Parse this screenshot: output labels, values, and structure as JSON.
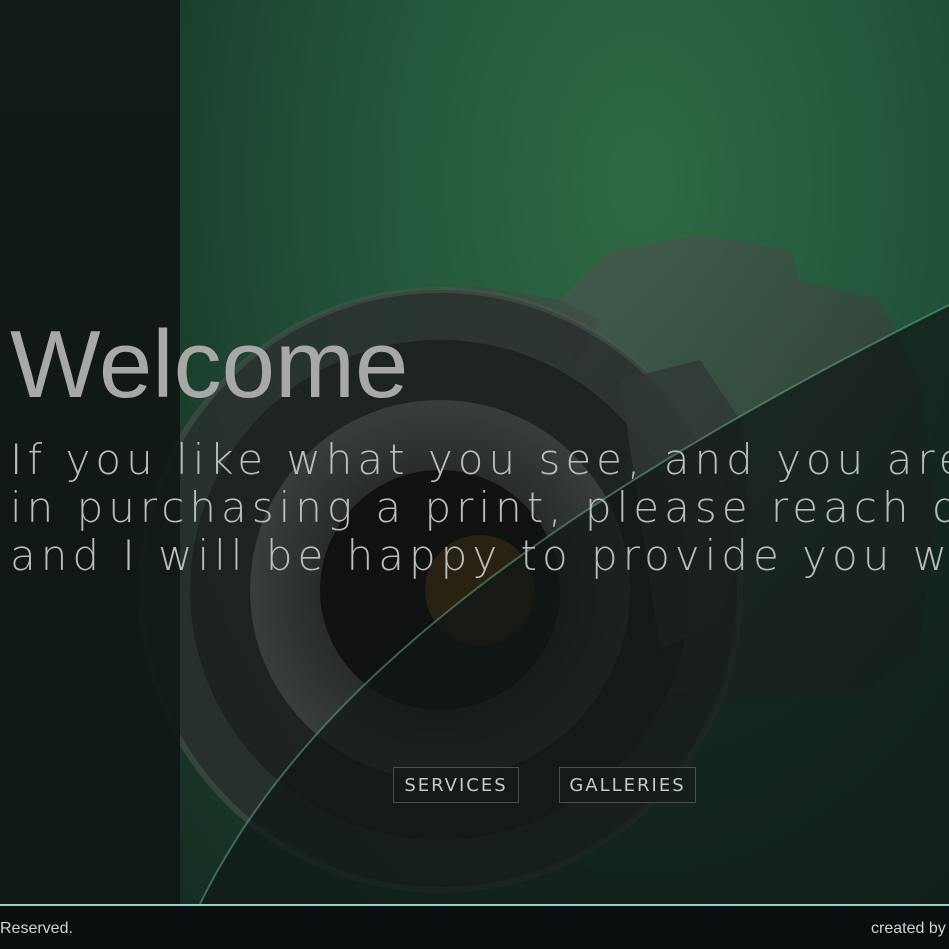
{
  "hero": {
    "heading": "Welcome",
    "intro_lines": [
      "If you like what you see, and you are inte",
      "in purchasing a print, please reach out to",
      "and I will be happy to provide you with a"
    ]
  },
  "buttons": {
    "services_label": "SERVICES",
    "galleries_label": "GALLERIES"
  },
  "footer": {
    "rights_text": "Reserved.",
    "credit_text": "created by"
  },
  "colors": {
    "accent_line": "#8fd6c9",
    "green_bg": "#22533a"
  },
  "icons": [
    "camera-image"
  ]
}
